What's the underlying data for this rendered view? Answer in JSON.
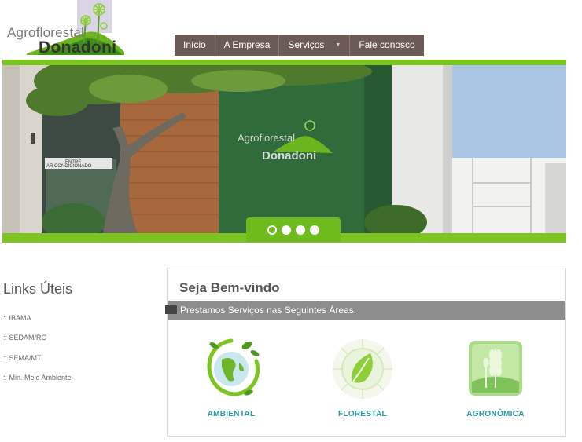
{
  "logo": {
    "line1": "Agroflorestal",
    "line2": "Donadoni",
    "icon": "palm-tree-mountain-logo"
  },
  "nav": {
    "items": [
      {
        "label": "Início"
      },
      {
        "label": "A Empresa"
      },
      {
        "label": "Serviços",
        "has_dropdown": true,
        "caret_icon": "caret-down-icon"
      },
      {
        "label": "Fale conosco"
      }
    ]
  },
  "banner": {
    "sign_line1": "Agroflorestal",
    "sign_line2": "Donadoni",
    "sticker_line1": "ENTRE",
    "sticker_line2": "AR CONDICIONADO",
    "slides": 4,
    "active_slide": 1
  },
  "sidebar": {
    "title": "Links Úteis",
    "links": [
      {
        "label": ":: IBAMA"
      },
      {
        "label": ":: SEDAM/RO"
      },
      {
        "label": ":: SEMA/MT"
      },
      {
        "label": ":: Min. Meio Ambiente"
      }
    ]
  },
  "welcome": {
    "title": "Seja Bem-vindo",
    "services_heading": "Prestamos Serviços nas Seguintes Áreas:",
    "services": [
      {
        "label": "AMBIENTAL",
        "icon": "globe-leaves-icon"
      },
      {
        "label": "FLORESTAL",
        "icon": "leaf-icon"
      },
      {
        "label": "AGRONÔMICA",
        "icon": "wheat-icon"
      }
    ]
  },
  "colors": {
    "accent_green": "#7cc420",
    "nav_background": "#6b5a55",
    "service_label": "#2e9a9a",
    "services_bar": "#8d8d8d"
  }
}
